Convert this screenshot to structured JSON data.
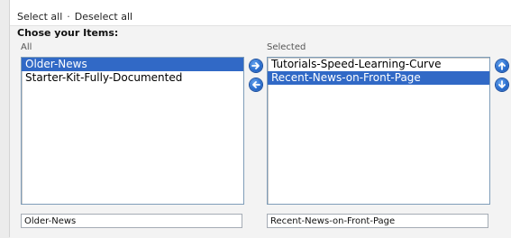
{
  "header": {
    "select_all": "Select all",
    "separator": "·",
    "deselect_all": "Deselect all"
  },
  "title": "Chose your Items:",
  "all": {
    "label": "All",
    "items": [
      "Older-News",
      "Starter-Kit-Fully-Documented"
    ],
    "selected_index": 0,
    "textbox_value": "Older-News"
  },
  "selected": {
    "label": "Selected",
    "items": [
      "Tutorials-Speed-Learning-Curve",
      "Recent-News-on-Front-Page"
    ],
    "selected_index": 1,
    "textbox_value": "Recent-News-on-Front-Page"
  },
  "icons": {
    "add": "arrow-right-icon",
    "remove": "arrow-left-icon",
    "move_up": "arrow-up-icon",
    "move_down": "arrow-down-icon"
  },
  "colors": {
    "selection": "#3169c6",
    "button": "#2b6fcf",
    "border": "#7f9db9"
  }
}
